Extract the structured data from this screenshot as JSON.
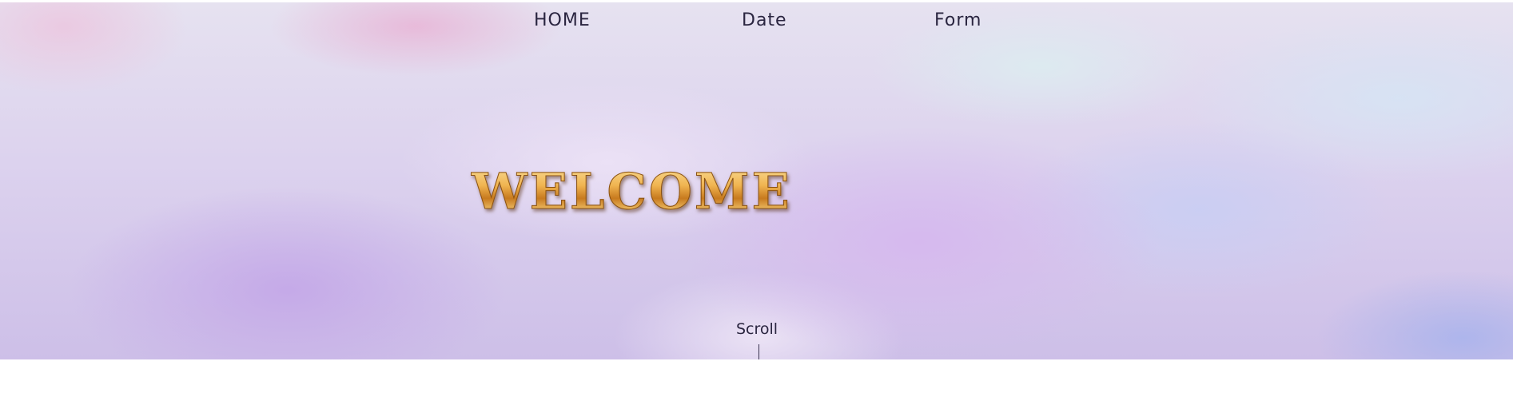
{
  "nav": {
    "items": [
      {
        "label": "HOME"
      },
      {
        "label": "Date"
      },
      {
        "label": "Form"
      }
    ]
  },
  "hero": {
    "title": "WELCOME",
    "scroll_label": "Scroll"
  },
  "colors": {
    "sky_pink": "#e8b4d6",
    "sky_purple": "#c4a8e8",
    "sky_blue": "#d6e4f4",
    "title_gold": "#f0b450",
    "text_dark": "#2a2540"
  }
}
